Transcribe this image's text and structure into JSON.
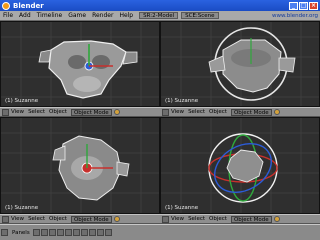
{
  "window": {
    "title": "Blender"
  },
  "menubar": {
    "items": [
      "File",
      "Add",
      "Timeline",
      "Game",
      "Render",
      "Help"
    ],
    "screen_field": "SR:2-Model",
    "scene_field": "SCE:Scene",
    "url": "www.blender.org"
  },
  "views": [
    {
      "label": "(1) Suzanne",
      "header": {
        "menus": [
          "View",
          "Select",
          "Object"
        ],
        "mode": "Object Mode"
      }
    },
    {
      "label": "(1) Suzanne",
      "header": {
        "menus": [
          "View",
          "Select",
          "Object"
        ],
        "mode": "Object Mode"
      }
    },
    {
      "label": "(1) Suzanne",
      "header": {
        "menus": [
          "View",
          "Select",
          "Object"
        ],
        "mode": "Object Mode"
      }
    },
    {
      "label": "(1) Suzanne",
      "header": {
        "menus": [
          "View",
          "Select",
          "Object"
        ],
        "mode": "Object Mode"
      }
    }
  ],
  "bottombar": {
    "panels_label": "Panels"
  },
  "colors": {
    "viewport_bg": "#2f2f2f",
    "grid": "#3d3d3d",
    "axis_x": "#c8302c",
    "axis_y": "#2fa83c",
    "axis_z": "#2c5cd8",
    "mesh": "#9a9a9a",
    "selection": "#f2f2f2"
  },
  "icons": [
    "blender-logo-icon",
    "minimize-icon",
    "maximize-icon",
    "close-icon",
    "view-menu-icon",
    "pivot-icon",
    "transform-manipulator-icon",
    "layer-icons"
  ]
}
